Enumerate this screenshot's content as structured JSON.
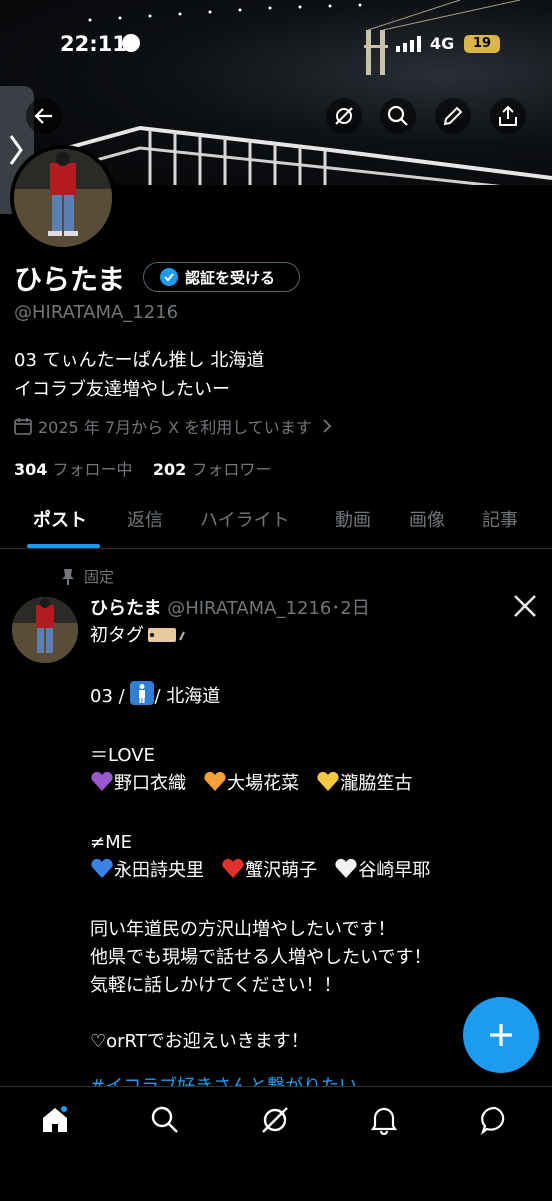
{
  "status_bar": {
    "time": "22:11",
    "network": "4G",
    "battery": "19"
  },
  "profile": {
    "display_name": "ひらたま",
    "verify_label": "認証を受ける",
    "handle": "@HIRATAMA_1216",
    "bio_line1": "03 てぃんたーぱん推し 北海道",
    "bio_line2": "イコラブ友達増やしたいー",
    "joined": "2025 年 7月から X を利用しています",
    "following_count": "304",
    "following_label": "フォロー中",
    "followers_count": "202",
    "followers_label": "フォロワー"
  },
  "tabs": [
    "ポスト",
    "返信",
    "ハイライト",
    "動画",
    "画像",
    "記事"
  ],
  "pinned_label": "固定",
  "post": {
    "name": "ひらたま",
    "meta": "@HIRATAMA_1216･2日",
    "line1": "初タグ",
    "line2a": "03 /",
    "line2b": "/ 北海道",
    "love_header": "＝LOVE",
    "love_1": "野口衣織",
    "love_2": "大場花菜",
    "love_3": "瀧脇笙古",
    "me_header": "≠ME",
    "me_1": "永田詩央里",
    "me_2": "蟹沢萌子",
    "me_3": "谷崎早耶",
    "para1": "同い年道民の方沢山増やしたいです！",
    "para2": "他県でも現場で話せる人増やしたいです！",
    "para3": "気軽に話しかけてください！！",
    "para4": "♡orRTでお迎えいきます！",
    "hashtag": "#イコラブ好きさんと繋がりたい"
  },
  "colors": {
    "accent": "#1d9bf0",
    "muted": "#71767b",
    "bg": "#000000"
  }
}
